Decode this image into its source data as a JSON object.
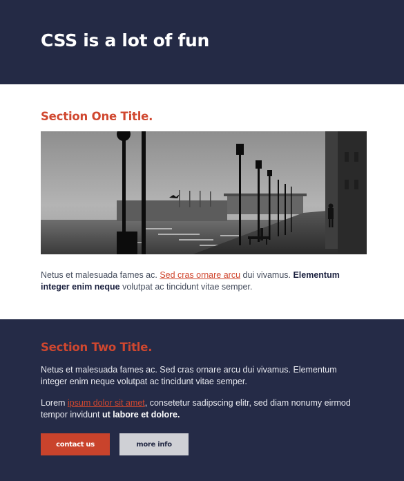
{
  "header": {
    "title": "CSS is a lot of fun"
  },
  "section_one": {
    "title": "Section One Title.",
    "para_start": "Netus et malesuada fames ac. ",
    "link": "Sed cras ornare arcu",
    "para_mid": " dui vivamus. ",
    "bold": "Elementum integer enim neque",
    "para_end": " volutpat ac tincidunt vitae semper."
  },
  "section_two": {
    "title": "Section Two Title.",
    "para1": "Netus et malesuada fames ac. Sed cras ornare arcu dui vivamus. Elementum integer enim neque volutpat ac tincidunt vitae semper.",
    "para2_start": "Lorem ",
    "link": "ipsum dolor sit amet",
    "para2_mid": ", consetetur sadipscing elitr, sed diam nonumy eirmod tempor invidunt ",
    "bold": "ut labore et dolore.",
    "buttons": {
      "contact": "contact us",
      "more": "more info"
    }
  },
  "colors": {
    "navy": "#242a45",
    "accent": "#d0472f",
    "white": "#ffffff"
  }
}
